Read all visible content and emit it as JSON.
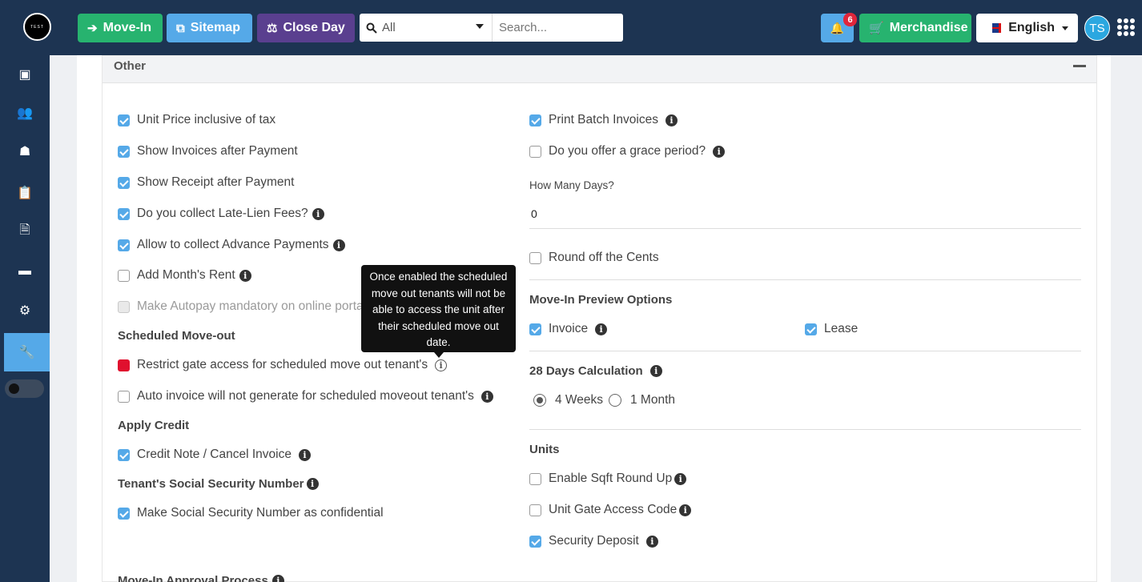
{
  "header": {
    "logo_text": "TEST",
    "move_in": "Move-In",
    "sitemap": "Sitemap",
    "close_day": "Close Day",
    "filter_value": "All",
    "search_placeholder": "Search...",
    "notification_count": "6",
    "merchandise": "Merchandise",
    "language": "English",
    "avatar": "TS"
  },
  "sidebar": {
    "items": [
      "dashboard-icon",
      "users-icon",
      "tenant-icon",
      "clipboard-icon",
      "document-icon",
      "payment-icon",
      "gear-icon",
      "wrench-icon"
    ],
    "active": "wrench-icon"
  },
  "section": {
    "title": "Other"
  },
  "left": {
    "unit_price": "Unit Price inclusive of tax",
    "show_invoices": "Show Invoices after Payment",
    "show_receipt": "Show Receipt after Payment",
    "late_lien": "Do you collect Late-Lien Fees?",
    "advance": "Allow to collect Advance Payments",
    "month_rent": "Add Month's Rent",
    "autopay": "Make Autopay mandatory on online portal",
    "scheduled_heading": "Scheduled Move-out",
    "restrict_gate": "Restrict gate access for scheduled move out tenant's",
    "auto_invoice": "Auto invoice will not generate for scheduled moveout tenant's",
    "apply_credit_heading": "Apply Credit",
    "credit_note": "Credit Note / Cancel Invoice",
    "ssn_heading": "Tenant's Social Security Number",
    "ssn_confidential": "Make Social Security Number as confidential",
    "approval_heading": "Move-In Approval Process"
  },
  "right": {
    "print_batch": "Print Batch Invoices",
    "grace": "Do you offer a grace period?",
    "how_many_label": "How Many Days?",
    "how_many_value": "0",
    "round_cents": "Round off the Cents",
    "preview_heading": "Move-In Preview Options",
    "invoice": "Invoice",
    "lease": "Lease",
    "days28_heading": "28 Days Calculation",
    "weeks4": "4 Weeks",
    "month1": "1 Month",
    "units_heading": "Units",
    "sqft": "Enable Sqft Round Up",
    "gate_code": "Unit Gate Access Code",
    "security_deposit": "Security Deposit"
  },
  "tooltip": "Once enabled the scheduled move out tenants will not be able to access the unit after their scheduled move out date.",
  "colors": {
    "nav": "#1d3452",
    "green": "#27b36f",
    "blue": "#55a9e8",
    "purple": "#5a3f8f",
    "red": "#e0102e"
  }
}
